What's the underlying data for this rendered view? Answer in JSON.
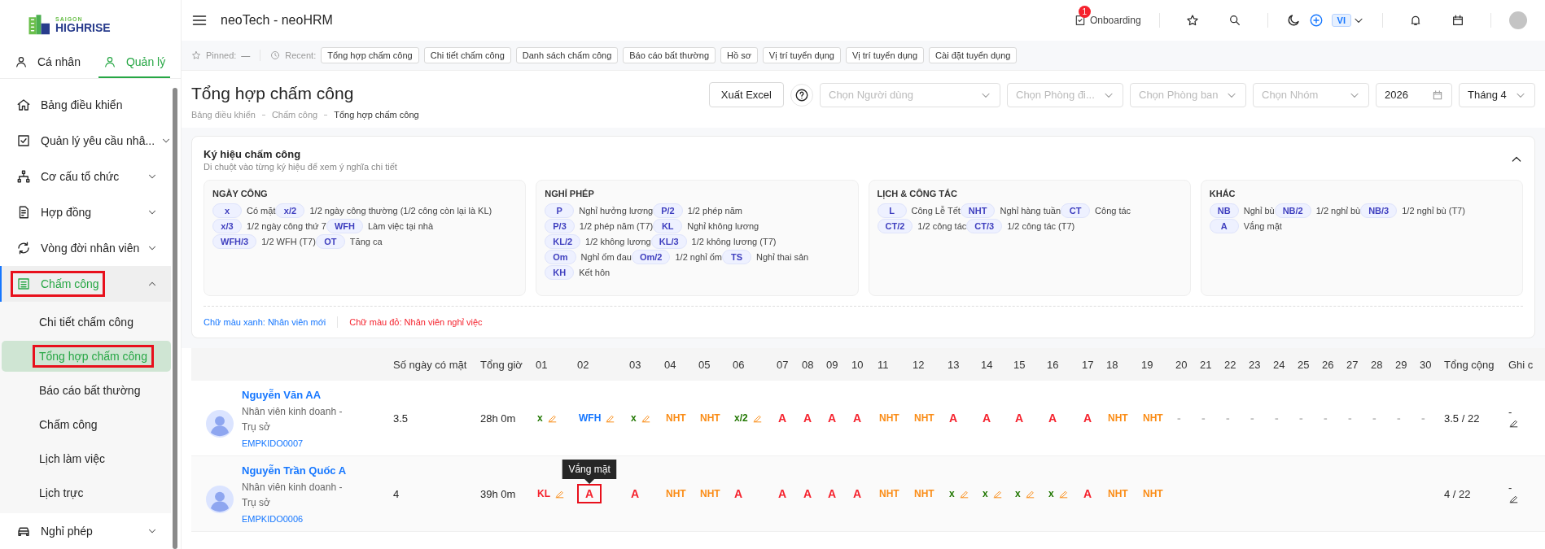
{
  "sidebar": {
    "logo": {
      "line1": "SAIGON",
      "line2": "HIGHRISE"
    },
    "tabs": [
      {
        "label": "Cá nhân",
        "selected": false
      },
      {
        "label": "Quản lý",
        "selected": true
      }
    ],
    "menu": [
      {
        "label": "Bảng điều khiển",
        "expandable": false,
        "selected": false,
        "highlighted": false
      },
      {
        "label": "Quản lý yêu cầu nhâ...",
        "expandable": true,
        "expanded": false,
        "selected": false,
        "highlighted": false
      },
      {
        "label": "Cơ cấu tổ chức",
        "expandable": true,
        "expanded": false,
        "selected": false,
        "highlighted": false
      },
      {
        "label": "Hợp đồng",
        "expandable": true,
        "expanded": false,
        "selected": false,
        "highlighted": false
      },
      {
        "label": "Vòng đời nhân viên",
        "expandable": true,
        "expanded": false,
        "selected": false,
        "highlighted": false
      },
      {
        "label": "Chấm công",
        "expandable": true,
        "expanded": true,
        "selected": true,
        "highlighted": true,
        "children": [
          {
            "label": "Chi tiết chấm công",
            "selected": false,
            "highlighted": false
          },
          {
            "label": "Tổng hợp chấm công",
            "selected": true,
            "highlighted": true
          },
          {
            "label": "Báo cáo bất thường",
            "selected": false,
            "highlighted": false
          },
          {
            "label": "Chấm công",
            "selected": false,
            "highlighted": false
          },
          {
            "label": "Lịch làm việc",
            "selected": false,
            "highlighted": false
          },
          {
            "label": "Lịch trực",
            "selected": false,
            "highlighted": false
          }
        ]
      },
      {
        "label": "Nghỉ phép",
        "expandable": true,
        "expanded": false,
        "selected": false,
        "highlighted": false
      }
    ]
  },
  "header": {
    "title": "neoTech - neoHRM",
    "onboarding": {
      "label": "Onboarding",
      "badge": "1"
    },
    "language": "VI"
  },
  "pinned_bar": {
    "pinned_label": "Pinned:",
    "pinned_value": "—",
    "recent_label": "Recent:",
    "recent": [
      "Tổng hợp chấm công",
      "Chi tiết chấm công",
      "Danh sách chấm công",
      "Báo cáo bất thường",
      "Hồ sơ",
      "Vị trí tuyển dụng",
      "Vị trí tuyển dụng",
      "Cài đặt tuyển dụng"
    ]
  },
  "page": {
    "title": "Tổng hợp chấm công",
    "breadcrumb": [
      {
        "label": "Bảng điều khiển",
        "current": false
      },
      {
        "label": "Chấm công",
        "current": false
      },
      {
        "label": "Tổng hợp chấm công",
        "current": true
      }
    ],
    "export_button": "Xuất Excel",
    "filters": [
      {
        "kind": "select",
        "placeholder": "Chọn Người dùng"
      },
      {
        "kind": "select",
        "placeholder": "Chọn Phòng đi..."
      },
      {
        "kind": "select",
        "placeholder": "Chọn Phòng ban"
      },
      {
        "kind": "select",
        "placeholder": "Chọn Nhóm"
      },
      {
        "kind": "date",
        "value": "2026"
      },
      {
        "kind": "select",
        "value": "Tháng 4"
      }
    ]
  },
  "legend": {
    "title": "Ký hiệu chấm công",
    "subtitle": "Di chuột vào từng ký hiệu để xem ý nghĩa chi tiết",
    "expanded": true,
    "groups": [
      {
        "title": "NGÀY CÔNG",
        "items": [
          {
            "code": "x",
            "label": "Có mặt"
          },
          {
            "code": "x/2",
            "label": "1/2 ngày công thường (1/2 công còn lại là KL)"
          },
          {
            "code": "x/3",
            "label": "1/2 ngày công thứ 7"
          },
          {
            "code": "WFH",
            "label": "Làm việc tại nhà"
          },
          {
            "code": "WFH/3",
            "label": "1/2 WFH (T7)"
          },
          {
            "code": "OT",
            "label": "Tăng ca"
          }
        ]
      },
      {
        "title": "NGHỈ PHÉP",
        "items": [
          {
            "code": "P",
            "label": "Nghỉ hưởng lương"
          },
          {
            "code": "P/2",
            "label": "1/2 phép năm"
          },
          {
            "code": "P/3",
            "label": "1/2 phép năm (T7)"
          },
          {
            "code": "KL",
            "label": "Nghỉ không lương"
          },
          {
            "code": "KL/2",
            "label": "1/2 không lương"
          },
          {
            "code": "KL/3",
            "label": "1/2 không lương (T7)"
          },
          {
            "code": "Om",
            "label": "Nghỉ ốm đau"
          },
          {
            "code": "Om/2",
            "label": "1/2 nghỉ ốm"
          },
          {
            "code": "TS",
            "label": "Nghỉ thai sản"
          },
          {
            "code": "KH",
            "label": "Kết hôn"
          }
        ]
      },
      {
        "title": "LỊCH & CÔNG TÁC",
        "items": [
          {
            "code": "L",
            "label": "Công Lễ Tết"
          },
          {
            "code": "NHT",
            "label": "Nghỉ hàng tuần"
          },
          {
            "code": "CT",
            "label": "Công tác"
          },
          {
            "code": "CT/2",
            "label": "1/2 công tác"
          },
          {
            "code": "CT/3",
            "label": "1/2 công tác (T7)"
          }
        ]
      },
      {
        "title": "KHÁC",
        "items": [
          {
            "code": "NB",
            "label": "Nghỉ bù"
          },
          {
            "code": "NB/2",
            "label": "1/2 nghỉ bù"
          },
          {
            "code": "NB/3",
            "label": "1/2 nghỉ bù (T7)"
          },
          {
            "code": "A",
            "label": "Vắng mặt"
          }
        ]
      }
    ],
    "notes": [
      {
        "text": "Chữ màu xanh: Nhân viên mới",
        "color": "#1677ff"
      },
      {
        "text": "Chữ màu đỏ: Nhân viên nghỉ việc",
        "color": "#f5222d"
      }
    ]
  },
  "table": {
    "columns": [
      "Số ngày có mặt",
      "Tổng giờ",
      "01",
      "02",
      "03",
      "04",
      "05",
      "06",
      "07",
      "08",
      "09",
      "10",
      "11",
      "12",
      "13",
      "14",
      "15",
      "16",
      "17",
      "18",
      "19",
      "20",
      "21",
      "22",
      "23",
      "24",
      "25",
      "26",
      "27",
      "28",
      "29",
      "30",
      "Tổng cộng",
      "Ghi c"
    ],
    "rows": [
      {
        "name": "Nguyễn Văn AA",
        "position": "Nhân viên kinh doanh - Trụ sở",
        "code": "EMPKIDO0007",
        "present_days": "3.5",
        "hours": "28h 0m",
        "total": "3.5 / 22",
        "note": "-",
        "days": [
          {
            "code": "x",
            "color": "#237804",
            "editable": true
          },
          {
            "code": "WFH",
            "color": "#1677ff",
            "editable": true
          },
          {
            "code": "x",
            "color": "#237804",
            "editable": true
          },
          {
            "code": "NHT",
            "color": "#fa8c16",
            "editable": false
          },
          {
            "code": "NHT",
            "color": "#fa8c16",
            "editable": false
          },
          {
            "code": "x/2",
            "color": "#237804",
            "editable": true
          },
          {
            "code": "A",
            "color": "#f5222d",
            "editable": false
          },
          {
            "code": "A",
            "color": "#f5222d",
            "editable": false
          },
          {
            "code": "A",
            "color": "#f5222d",
            "editable": false
          },
          {
            "code": "A",
            "color": "#f5222d",
            "editable": false
          },
          {
            "code": "NHT",
            "color": "#fa8c16",
            "editable": false
          },
          {
            "code": "NHT",
            "color": "#fa8c16",
            "editable": false
          },
          {
            "code": "A",
            "color": "#f5222d",
            "editable": false
          },
          {
            "code": "A",
            "color": "#f5222d",
            "editable": false
          },
          {
            "code": "A",
            "color": "#f5222d",
            "editable": false
          },
          {
            "code": "A",
            "color": "#f5222d",
            "editable": false
          },
          {
            "code": "A",
            "color": "#f5222d",
            "editable": false
          },
          {
            "code": "NHT",
            "color": "#fa8c16",
            "editable": false
          },
          {
            "code": "NHT",
            "color": "#fa8c16",
            "editable": false
          },
          {
            "code": "-",
            "color": "#bfbfbf",
            "editable": false
          },
          {
            "code": "-",
            "color": "#bfbfbf",
            "editable": false
          },
          {
            "code": "-",
            "color": "#bfbfbf",
            "editable": false
          },
          {
            "code": "-",
            "color": "#bfbfbf",
            "editable": false
          },
          {
            "code": "-",
            "color": "#bfbfbf",
            "editable": false
          },
          {
            "code": "-",
            "color": "#bfbfbf",
            "editable": false
          },
          {
            "code": "-",
            "color": "#bfbfbf",
            "editable": false
          },
          {
            "code": "-",
            "color": "#bfbfbf",
            "editable": false
          },
          {
            "code": "-",
            "color": "#bfbfbf",
            "editable": false
          },
          {
            "code": "-",
            "color": "#bfbfbf",
            "editable": false
          },
          {
            "code": "-",
            "color": "#bfbfbf",
            "editable": false
          }
        ]
      },
      {
        "name": "Nguyễn Trần Quốc A",
        "position": "Nhân viên kinh doanh - Trụ sở",
        "code": "EMPKIDO0006",
        "present_days": "4",
        "hours": "39h 0m",
        "total": "4 / 22",
        "note": "-",
        "days": [
          {
            "code": "KL",
            "color": "#f5222d",
            "editable": true
          },
          {
            "code": "A",
            "color": "#f5222d",
            "editable": false,
            "highlighted": true,
            "tooltip": "Vắng mặt"
          },
          {
            "code": "A",
            "color": "#f5222d",
            "editable": false
          },
          {
            "code": "NHT",
            "color": "#fa8c16",
            "editable": false
          },
          {
            "code": "NHT",
            "color": "#fa8c16",
            "editable": false
          },
          {
            "code": "A",
            "color": "#f5222d",
            "editable": false
          },
          {
            "code": "A",
            "color": "#f5222d",
            "editable": false
          },
          {
            "code": "A",
            "color": "#f5222d",
            "editable": false
          },
          {
            "code": "A",
            "color": "#f5222d",
            "editable": false
          },
          {
            "code": "A",
            "color": "#f5222d",
            "editable": false
          },
          {
            "code": "NHT",
            "color": "#fa8c16",
            "editable": false
          },
          {
            "code": "NHT",
            "color": "#fa8c16",
            "editable": false
          },
          {
            "code": "x",
            "color": "#237804",
            "editable": true
          },
          {
            "code": "x",
            "color": "#237804",
            "editable": true
          },
          {
            "code": "x",
            "color": "#237804",
            "editable": true
          },
          {
            "code": "x",
            "color": "#237804",
            "editable": true
          },
          {
            "code": "A",
            "color": "#f5222d",
            "editable": false
          },
          {
            "code": "NHT",
            "color": "#fa8c16",
            "editable": false
          },
          {
            "code": "NHT",
            "color": "#fa8c16",
            "editable": false
          }
        ]
      }
    ]
  }
}
